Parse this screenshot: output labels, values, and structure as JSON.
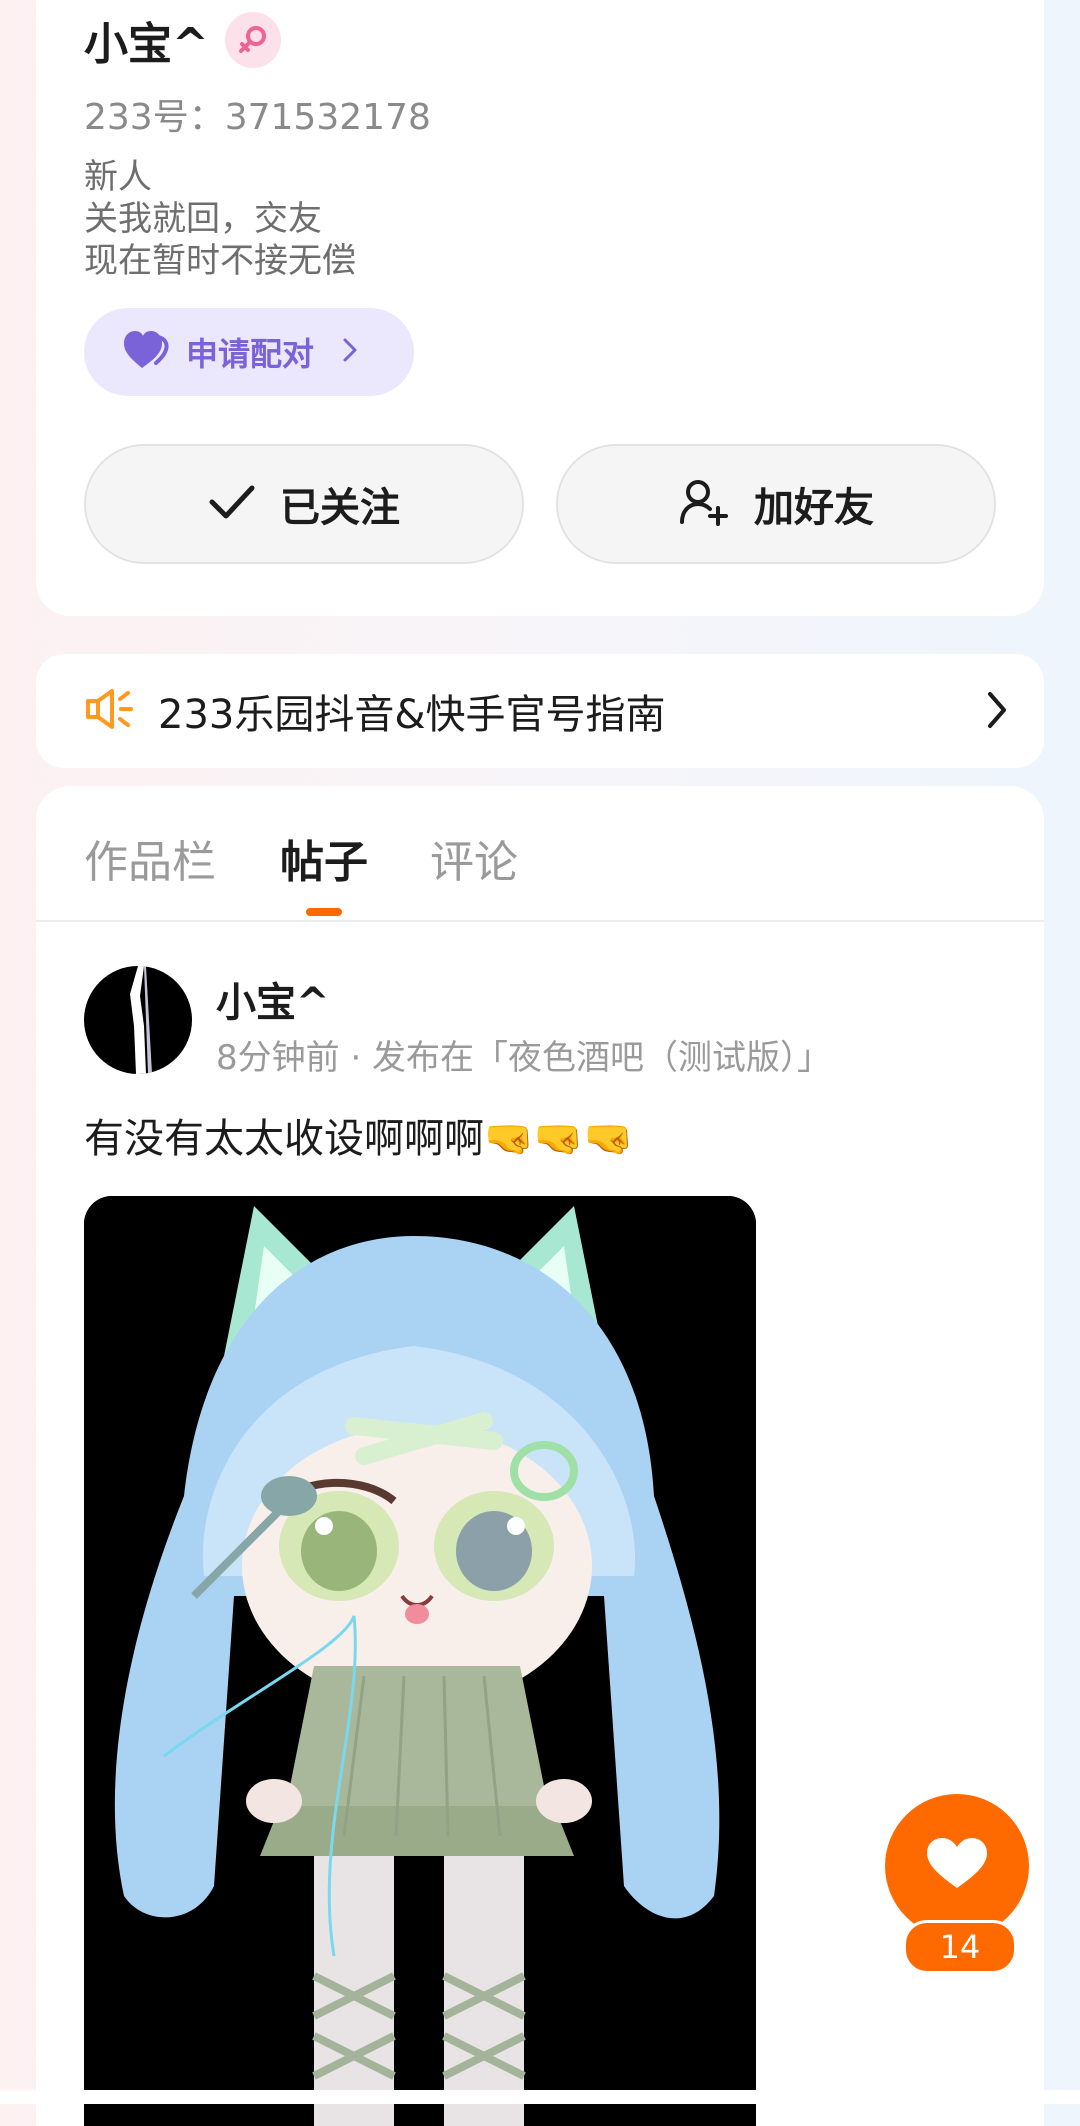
{
  "profile": {
    "name": "小宝^",
    "uid": "233号：371532178",
    "bio": [
      "新人",
      "关我就回，交友",
      "现在暂时不接无偿"
    ],
    "pair_button": "申请配对",
    "follow_button": "已关注",
    "add_friend_button": "加好友"
  },
  "notice": {
    "text": "233乐园抖音&快手官号指南"
  },
  "tabs": [
    {
      "label": "作品栏",
      "active": false
    },
    {
      "label": "帖子",
      "active": true
    },
    {
      "label": "评论",
      "active": false
    }
  ],
  "post": {
    "author": "小宝^",
    "meta": "8分钟前 · 发布在「夜色酒吧（测试版）」",
    "text": "有没有太太收设啊啊啊",
    "emoji": "🤜🤜🤜"
  },
  "like": {
    "count": "14"
  },
  "colors": {
    "accent": "#ff6a00",
    "pair": "#7a63d8",
    "pair_bg": "#ebe7fc",
    "notice_icon": "#ff9a1f",
    "gender": "#f06292"
  },
  "icons": {
    "gender": "female-icon",
    "pair": "heart-icon",
    "follow": "check-icon",
    "add_friend": "add-user-icon",
    "notice": "megaphone-icon",
    "chevron": "chevron-right-icon",
    "like": "heart-icon"
  }
}
